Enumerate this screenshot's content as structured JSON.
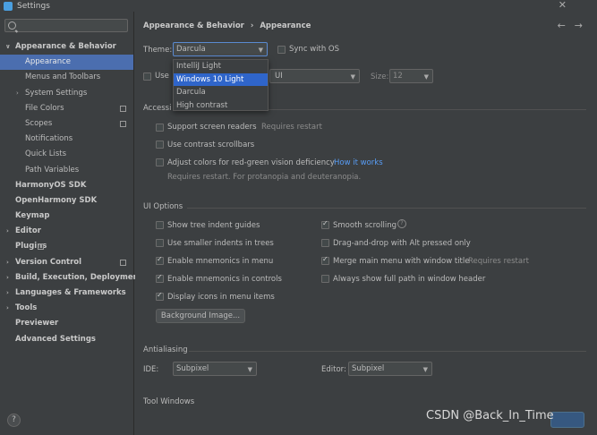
{
  "window": {
    "title": "Settings"
  },
  "search": {
    "placeholder": ""
  },
  "sidebar": {
    "items": [
      {
        "label": "Appearance & Behavior",
        "bold": true,
        "expanded": true
      },
      {
        "label": "Appearance",
        "selected": true
      },
      {
        "label": "Menus and Toolbars"
      },
      {
        "label": "System Settings",
        "collapsed": true
      },
      {
        "label": "File Colors"
      },
      {
        "label": "Scopes"
      },
      {
        "label": "Notifications"
      },
      {
        "label": "Quick Lists"
      },
      {
        "label": "Path Variables"
      },
      {
        "label": "HarmonyOS SDK",
        "bold": true
      },
      {
        "label": "OpenHarmony SDK",
        "bold": true
      },
      {
        "label": "Keymap",
        "bold": true
      },
      {
        "label": "Editor",
        "bold": true
      },
      {
        "label": "Plugins",
        "bold": true
      },
      {
        "label": "Version Control",
        "bold": true
      },
      {
        "label": "Build, Execution, Deployment",
        "bold": true
      },
      {
        "label": "Languages & Frameworks",
        "bold": true
      },
      {
        "label": "Tools",
        "bold": true
      },
      {
        "label": "Previewer",
        "bold": true
      },
      {
        "label": "Advanced Settings",
        "bold": true
      }
    ]
  },
  "main": {
    "breadcrumb_parent": "Appearance & Behavior",
    "breadcrumb_sep": "›",
    "breadcrumb_current": "Appearance",
    "theme_label": "Theme:",
    "theme_value": "Darcula",
    "sync_label": "Sync with OS",
    "theme_options": [
      "IntelliJ Light",
      "Windows 10 Light",
      "Darcula",
      "High contrast"
    ],
    "theme_options_selected": "Windows 10 Light",
    "use_font_label": "Use",
    "font_value": "UI",
    "size_label": "Size:",
    "size_value": "12",
    "accessibility_title": "Accessi",
    "support_readers": "Support screen readers",
    "requires_restart_1": "Requires restart",
    "contrast_scrollbars": "Use contrast scrollbars",
    "adjust_colors": "Adjust colors for red-green vision deficiency",
    "how_it_works": "How it works",
    "requires_restart_note": "Requires restart. For protanopia and deuteranopia.",
    "ui_options_title": "UI Options",
    "show_tree_guides": "Show tree indent guides",
    "smaller_indents": "Use smaller indents in trees",
    "enable_mnemonics_menu": "Enable mnemonics in menu",
    "enable_mnemonics_controls": "Enable mnemonics in controls",
    "display_icons": "Display icons in menu items",
    "background_image": "Background Image...",
    "smooth_scrolling": "Smooth scrolling",
    "drag_drop_alt": "Drag-and-drop with Alt pressed only",
    "merge_main_menu": "Merge main menu with window title",
    "requires_restart_2": "Requires restart",
    "show_full_path": "Always show full path in window header",
    "antialiasing_title": "Antialiasing",
    "ide_label": "IDE:",
    "ide_value": "Subpixel",
    "editor_label": "Editor:",
    "editor_value": "Subpixel",
    "tool_windows_title": "Tool Windows"
  },
  "footer": {
    "help": "?",
    "watermark": "CSDN @Back_In_Time"
  }
}
